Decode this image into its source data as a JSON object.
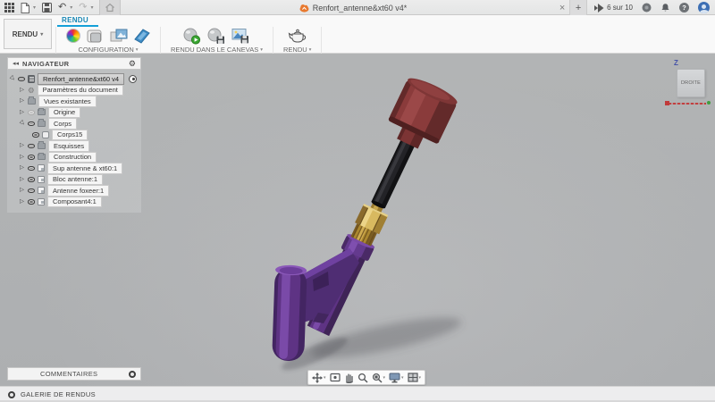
{
  "titlebar": {
    "document_tab": "Renfort_antenne&xt60 v4*",
    "quota": "6 sur 10"
  },
  "ribbon": {
    "workspace": "RENDU",
    "tab": "RENDU",
    "groups": [
      "CONFIGURATION",
      "RENDU DANS LE CANEVAS",
      "RENDU"
    ]
  },
  "navigator": {
    "title": "NAVIGATEUR",
    "items": [
      {
        "label": "Renfort_antenne&xt60 v4"
      },
      {
        "label": "Paramètres du document"
      },
      {
        "label": "Vues existantes"
      },
      {
        "label": "Origine"
      },
      {
        "label": "Corps"
      },
      {
        "label": "Corps15"
      },
      {
        "label": "Esquisses"
      },
      {
        "label": "Construction"
      },
      {
        "label": "Sup antenne & xt60:1"
      },
      {
        "label": "Bloc antenne:1"
      },
      {
        "label": "Antenne foxeer:1"
      },
      {
        "label": "Composant4:1"
      }
    ]
  },
  "panels": {
    "comments": "COMMENTAIRES",
    "gallery": "GALERIE DE RENDUS"
  },
  "viewcube": {
    "face": "DROITE",
    "axis_z": "Z"
  },
  "icons": {
    "caret_down": "▾",
    "undo": "↶",
    "redo": "↷",
    "tree_collapsed": "▷",
    "gear": "⚙",
    "panel_collapse": "◂◂",
    "close_tab": "×",
    "new_tab": "+",
    "help": "?"
  },
  "colors": {
    "accent_blue": "#14a0d8",
    "canvas_gray": "#afb1b3",
    "model_purple": "#5e3384",
    "model_gold": "#c9a54f",
    "model_black": "#1b1b1e",
    "model_cap_red": "#8a3a3a"
  }
}
